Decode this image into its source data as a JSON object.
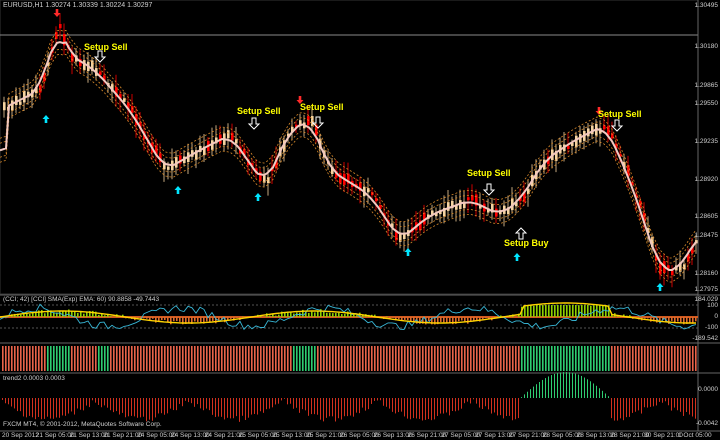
{
  "header": {
    "symbol_line": "EURUSD,H1  1.30274 1.30339 1.30224 1.30297"
  },
  "price_axis": {
    "ticks": [
      "1.30495",
      "1.30180",
      "1.29865",
      "1.29550",
      "1.29235",
      "1.28920",
      "1.28605",
      "1.28475",
      "1.28160",
      "1.27975"
    ]
  },
  "annotations": {
    "setup_sell": "Setup Sell",
    "setup_buy": "Setup Buy"
  },
  "cci_panel": {
    "title": "(CCI; 42) [CCI] SMA(Exp) EMA: 60) 90.8858 -49.7443",
    "ticks": [
      "184.029",
      "100",
      "0",
      "-100",
      "-189.542"
    ]
  },
  "trend_panel": {
    "title": "trend2 0.0003 0.0003",
    "ticks": [
      "0.0000",
      "-0.0042"
    ]
  },
  "footer": {
    "copyright": "FXCM MT4, © 2001-2012, MetaQuotes Software Corp."
  },
  "time_axis": {
    "ticks": [
      "20 Sep 2012",
      "21 Sep 05:00",
      "21 Sep 13:00",
      "21 Sep 21:00",
      "24 Sep 05:00",
      "24 Sep 13:00",
      "24 Sep 21:00",
      "25 Sep 05:00",
      "25 Sep 13:00",
      "25 Sep 21:00",
      "26 Sep 05:00",
      "26 Sep 13:00",
      "26 Sep 21:00",
      "27 Sep 05:00",
      "27 Sep 13:00",
      "27 Sep 21:00",
      "28 Sep 05:00",
      "28 Sep 13:00",
      "28 Sep 21:00",
      "30 Sep 21:00",
      "1 Oct 05:00"
    ]
  },
  "colors": {
    "bull": "#f5d3a0",
    "bear": "#ff0000",
    "ma": "#f2c9c0",
    "band": "#d98a2a",
    "up_arrow": "#00e5ff",
    "down_arrow": "#ff2a2a",
    "cci_line": "#38b8d8",
    "cci_signal": "#ffd400",
    "hist_pos": "#8fd000",
    "hist_neg": "#e06a2c",
    "green_bar": "#2ecc71"
  }
}
